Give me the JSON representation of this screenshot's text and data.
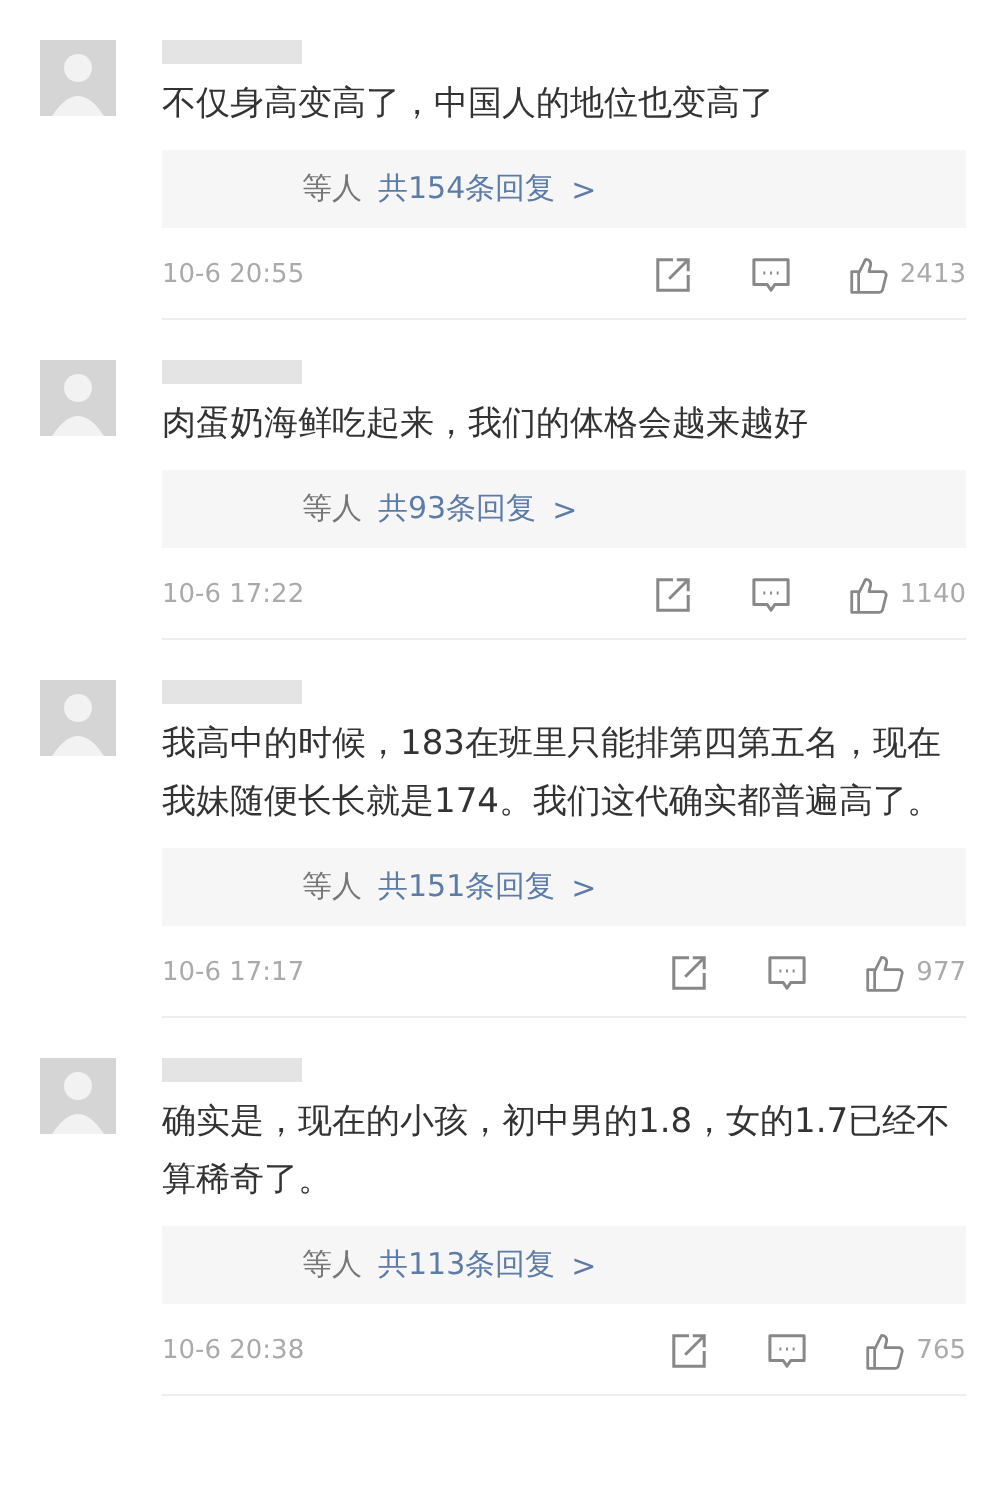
{
  "comments": [
    {
      "text": "不仅身高变高了，中国人的地位也变高了",
      "reply": {
        "others": "等人",
        "total": "共154条回复",
        "chevron": ">"
      },
      "time": "10-6 20:55",
      "likes": "2413"
    },
    {
      "text": "肉蛋奶海鲜吃起来，我们的体格会越来越好",
      "reply": {
        "others": "等人",
        "total": "共93条回复",
        "chevron": ">"
      },
      "time": "10-6 17:22",
      "likes": "1140"
    },
    {
      "text": "我高中的时候，183在班里只能排第四第五名，现在我妹随便长长就是174。我们这代确实都普遍高了。",
      "reply": {
        "others": "等人",
        "total": "共151条回复",
        "chevron": ">"
      },
      "time": "10-6 17:17",
      "likes": "977"
    },
    {
      "text": "确实是，现在的小孩，初中男的1.8，女的1.7已经不算稀奇了。",
      "reply": {
        "others": "等人",
        "total": "共113条回复",
        "chevron": ">"
      },
      "time": "10-6 20:38",
      "likes": "765"
    }
  ]
}
